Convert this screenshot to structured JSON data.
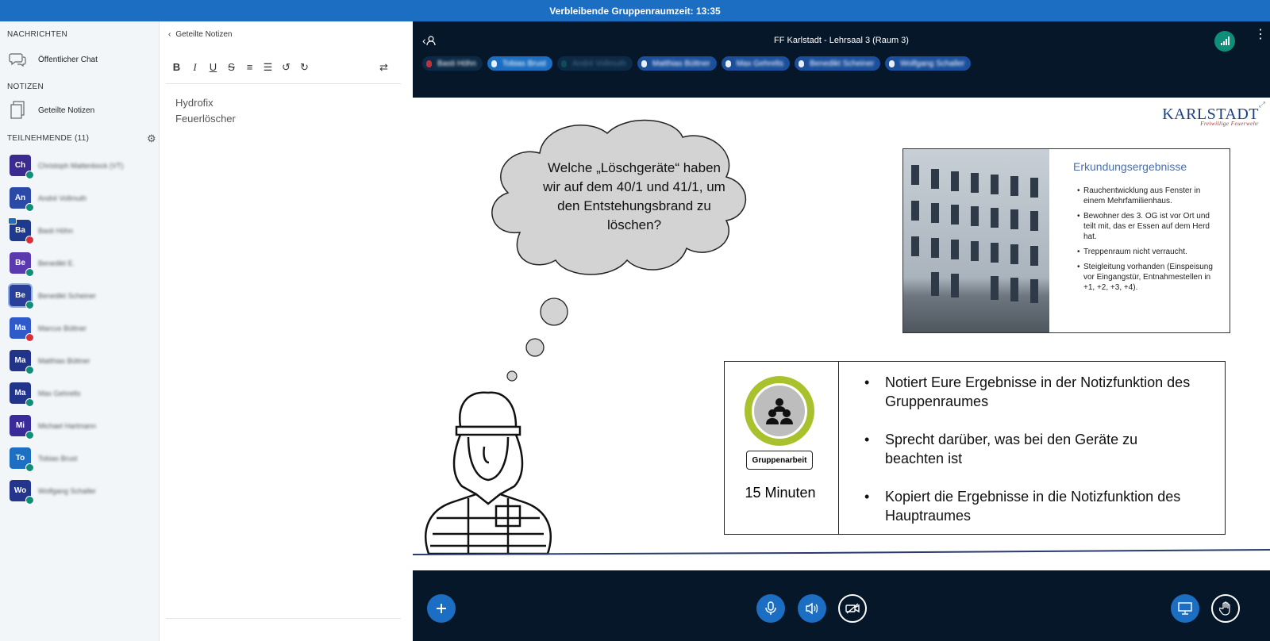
{
  "topbar": {
    "timer_text": "Verbleibende Gruppenraumzeit: 13:35"
  },
  "sidebar": {
    "messages_title": "NACHRICHTEN",
    "public_chat": "Öffentlicher Chat",
    "notes_title": "NOTIZEN",
    "shared_notes": "Geteilte Notizen",
    "participants_title": "TEILNEHMENDE (11)",
    "participants": [
      {
        "initials": "Ch",
        "name": "Christoph Mattenbock (VT)",
        "color": "#3b2a8f",
        "mic": "green"
      },
      {
        "initials": "An",
        "name": "André Vollmuth",
        "color": "#2b4aa8",
        "mic": "green"
      },
      {
        "initials": "Ba",
        "name": "Basti Höhn",
        "color": "#1d3a8f",
        "mic": "red",
        "presenter": true
      },
      {
        "initials": "Be",
        "name": "Benedikt E.",
        "color": "#5b3ab0",
        "mic": "green"
      },
      {
        "initials": "Be",
        "name": "Benedikt Scheiner",
        "color": "#2a3f9a",
        "mic": "green",
        "highlight": true
      },
      {
        "initials": "Ma",
        "name": "Marcus Büttner",
        "color": "#2e5bc9",
        "mic": "red"
      },
      {
        "initials": "Ma",
        "name": "Matthias Büttner",
        "color": "#22338a",
        "mic": "green"
      },
      {
        "initials": "Ma",
        "name": "Max Gehrelts",
        "color": "#22338a",
        "mic": "green"
      },
      {
        "initials": "Mi",
        "name": "Michael Hartmann",
        "color": "#3a2a9a",
        "mic": "green"
      },
      {
        "initials": "To",
        "name": "Tobias Brust",
        "color": "#1c6fc2",
        "mic": "green"
      },
      {
        "initials": "Wo",
        "name": "Wolfgang Schaller",
        "color": "#24358e",
        "mic": "green"
      }
    ]
  },
  "notes": {
    "back_label": "Geteilte Notizen",
    "line1": "Hydrofix",
    "line2": "Feuerlöscher",
    "toolbar": {
      "bold": "B",
      "italic": "I",
      "underline": "U",
      "strike": "S",
      "ol": "≡",
      "ul": "☰",
      "undo": "↺",
      "redo": "↻",
      "switch": "⇄"
    }
  },
  "meeting": {
    "room_title": "FF Karlstadt - Lehrsaal 3 (Raum 3)",
    "talkers": [
      "Basti Höhn",
      "Tobias Brust",
      "André Vollmuth",
      "Matthias Büttner",
      "Max Gehrelts",
      "Benedikt Scheiner",
      "Wolfgang Schaller"
    ]
  },
  "slide": {
    "logo_main": "KARLSTADT",
    "logo_sub": "Freiwillige Feuerwehr",
    "bubble_text": "Welche „Löschgeräte“ haben wir auf dem 40/1 und 41/1, um den Entstehungsbrand zu löschen?",
    "inset_title": "Erkundungsergebnisse",
    "inset_items": [
      "Rauchentwicklung aus Fenster in einem Mehrfamilienhaus.",
      "Bewohner des 3. OG ist vor Ort und teilt mit, das er Essen auf dem Herd hat.",
      "Treppenraum nicht verraucht.",
      "Steigleitung vorhanden (Einspeisung vor Eingangstür, Entnahmestellen in +1, +2, +3, +4)."
    ],
    "badge_label": "Gruppenarbeit",
    "minutes": "15 Minuten",
    "tasks": [
      "Notiert Eure Ergebnisse in der Notizfunktion des Gruppenraumes",
      "Sprecht darüber, was bei den Geräte zu beachten ist",
      "Kopiert die Ergebnisse in die Notizfunktion des Hauptraumes"
    ]
  }
}
